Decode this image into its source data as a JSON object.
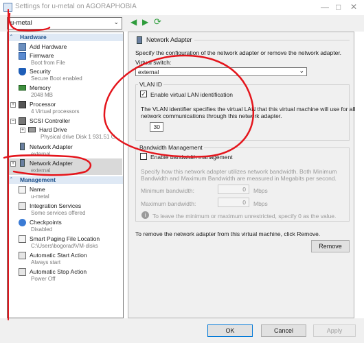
{
  "window": {
    "title": "Settings for u-metal on AGORAPHOBIA"
  },
  "vm_select": {
    "value": "u-metal"
  },
  "hardware": {
    "header": "Hardware",
    "items": [
      {
        "label": "Add Hardware",
        "sub": ""
      },
      {
        "label": "Firmware",
        "sub": "Boot from File"
      },
      {
        "label": "Security",
        "sub": "Secure Boot enabled"
      },
      {
        "label": "Memory",
        "sub": "2048 MB"
      },
      {
        "label": "Processor",
        "sub": "4 Virtual processors"
      },
      {
        "label": "SCSI Controller",
        "sub": ""
      },
      {
        "label": "Hard Drive",
        "sub": "Physical drive Disk 1 931.51 G..."
      },
      {
        "label": "Network Adapter",
        "sub": "external"
      },
      {
        "label": "Network Adapter",
        "sub": "external"
      }
    ]
  },
  "management": {
    "header": "Management",
    "items": [
      {
        "label": "Name",
        "sub": "u-metal"
      },
      {
        "label": "Integration Services",
        "sub": "Some services offered"
      },
      {
        "label": "Checkpoints",
        "sub": "Disabled"
      },
      {
        "label": "Smart Paging File Location",
        "sub": "C:\\Users\\bogorad\\VM-disks"
      },
      {
        "label": "Automatic Start Action",
        "sub": "Always start"
      },
      {
        "label": "Automatic Stop Action",
        "sub": "Power Off"
      }
    ]
  },
  "panel": {
    "title": "Network Adapter",
    "description": "Specify the configuration of the network adapter or remove the network adapter.",
    "virtual_switch_label": "Virtual switch:",
    "virtual_switch_value": "external",
    "vlan": {
      "title": "VLAN ID",
      "checkbox_label": "Enable virtual LAN identification",
      "checked": true,
      "desc_line1": "The VLAN identifier specifies the virtual LAN that this virtual machine will use for all",
      "desc_line2": "network communications through this network adapter.",
      "value": "30"
    },
    "bandwidth": {
      "title": "Bandwidth Management",
      "checkbox_label": "Enable bandwidth management",
      "checked": false,
      "desc_line1": "Specify how this network adapter utilizes network bandwidth. Both Minimum",
      "desc_line2": "Bandwidth and Maximum Bandwidth are measured in Megabits per second.",
      "min_label": "Minimum bandwidth:",
      "min_value": "0",
      "max_label": "Maximum bandwidth:",
      "max_value": "0",
      "unit": "Mbps",
      "hint": "To leave the minimum or maximum unrestricted, specify 0 as the value."
    },
    "remove_text": "To remove the network adapter from this virtual machine, click Remove.",
    "remove_button": "Remove"
  },
  "buttons": {
    "ok": "OK",
    "cancel": "Cancel",
    "apply": "Apply"
  },
  "colors": {
    "annotation": "#e4151c",
    "section_header_bg": "#dfe9f5",
    "accent": "#0078d7"
  }
}
